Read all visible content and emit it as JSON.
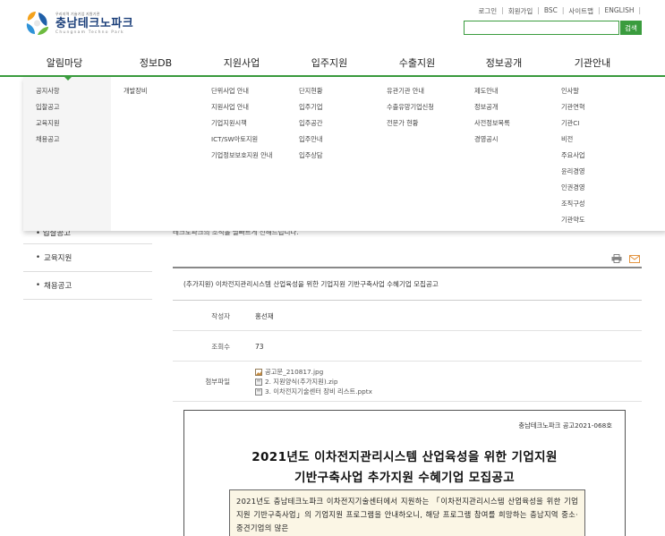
{
  "header": {
    "logo_small": "우리지역 기술기업 지원기관",
    "logo_name": "충남테크노파크",
    "logo_eng": "Chungnam Techno Park",
    "util_links": [
      "로그인",
      "회원가입",
      "BSC",
      "사이트맵",
      "ENGLISH"
    ],
    "search_value": "",
    "search_button": "검색"
  },
  "gnb": {
    "items": [
      "알림마당",
      "정보DB",
      "지원사업",
      "입주지원",
      "수출지원",
      "정보공개",
      "기관안내"
    ],
    "active_index": 0
  },
  "mega_menu": {
    "columns": [
      [
        "공지사항",
        "입찰공고",
        "교육지원",
        "채용공고"
      ],
      [
        "개발장비"
      ],
      [
        "단위사업 안내",
        "지원사업 안내",
        "기업지원시책",
        "ICT/SW아토지원",
        "기업정보보호지원 안내"
      ],
      [
        "단지현황",
        "입주기업",
        "입주공간",
        "입주안내",
        "입주상담"
      ],
      [
        "유관기관 안내",
        "수출유망기업신청",
        "전문가 현황"
      ],
      [
        "제도안내",
        "정보공개",
        "사전정보목록",
        "경영공시"
      ],
      [
        "인사말",
        "기관연혁",
        "기관CI",
        "비전",
        "주요사업",
        "윤리경영",
        "인권경영",
        "조직구성",
        "기관약도"
      ]
    ]
  },
  "sidebar": {
    "items": [
      "입찰공고",
      "교육지원",
      "채용공고"
    ]
  },
  "content": {
    "intro_text": "테크노파크의 소식을 빨빠르게 전해드립니다.",
    "post_title": "(추가지원) 이차전지관리시스템 산업육성을 위한 기업지원 기반구축사업 수혜기업 모집공고",
    "author_label": "작성자",
    "author": "홍선재",
    "views_label": "조회수",
    "views": "73",
    "attach_label": "첨부파일",
    "attachments": [
      "공고문_210817.jpg",
      "2. 지원양식(추가지원).zip",
      "3. 이차전지기술센터 장비 리스트.pptx"
    ]
  },
  "document": {
    "notice_no": "충남테크노파크 공고2021-068호",
    "title_line1": "2021년도 이차전지관리시스템 산업육성을 위한 기업지원",
    "title_line2": "기반구축사업 추가지원 수혜기업 모집공고",
    "body": "2021년도 충남테크노파크 이차전지기술센터에서 지원하는 「이차전지관리시스템 산업육성을 위한 기업지원 기반구축사업」의 기업지원 프로그램을 안내하오니, 해당 프로그램 참여를 희망하는 충남지역 중소·중견기업의 많은"
  },
  "colors": {
    "accent": "#3a9c3e",
    "brand_navy": "#1b3f7a",
    "doc_box_bg": "#fbf6e5"
  }
}
